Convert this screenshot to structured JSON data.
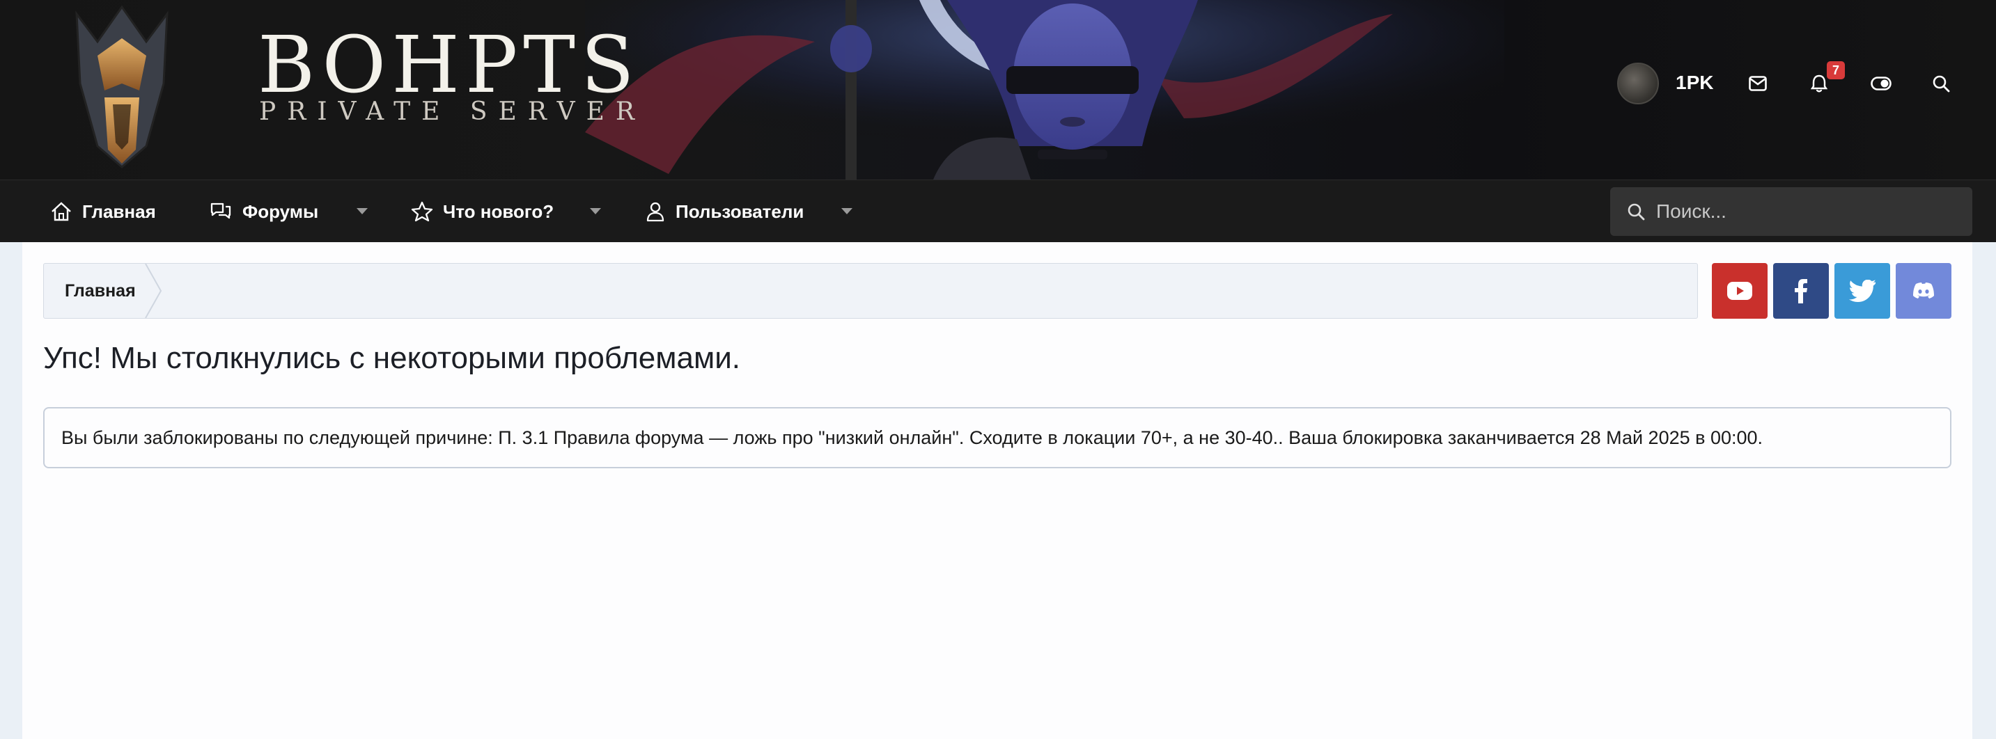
{
  "header": {
    "logo_title": "BOHPTS",
    "logo_subtitle": "PRIVATE SERVER",
    "username": "1PK",
    "notification_count": "7",
    "icons": [
      "envelope-icon",
      "bell-icon",
      "theme-toggle-icon",
      "search-icon"
    ]
  },
  "nav": {
    "items": [
      {
        "label": "Главная",
        "icon": "home-icon",
        "dropdown": false
      },
      {
        "label": "Форумы",
        "icon": "comments-icon",
        "dropdown": true
      },
      {
        "label": "Что нового?",
        "icon": "star-icon",
        "dropdown": true
      },
      {
        "label": "Пользователи",
        "icon": "user-icon",
        "dropdown": true
      }
    ],
    "search_placeholder": "Поиск..."
  },
  "breadcrumb": {
    "items": [
      "Главная"
    ]
  },
  "social": [
    {
      "name": "youtube",
      "color": "#c9302c"
    },
    {
      "name": "facebook",
      "color": "#2f4a86"
    },
    {
      "name": "twitter",
      "color": "#3a9bd8"
    },
    {
      "name": "discord",
      "color": "#7289da"
    }
  ],
  "page": {
    "title": "Упс! Мы столкнулись с некоторыми проблемами.",
    "message": "Вы были заблокированы по следующей причине: П. 3.1 Правила форума — ложь про \"низкий онлайн\". Сходите в локации 70+, а не 30-40.. Ваша блокировка заканчивается 28 Май 2025 в 00:00."
  },
  "colors": {
    "header_bg": "#151515",
    "nav_bg": "#1a1a1a",
    "badge": "#d83a3a",
    "page_bg": "#eaf0f6",
    "content_bg": "#fdfdfe"
  }
}
